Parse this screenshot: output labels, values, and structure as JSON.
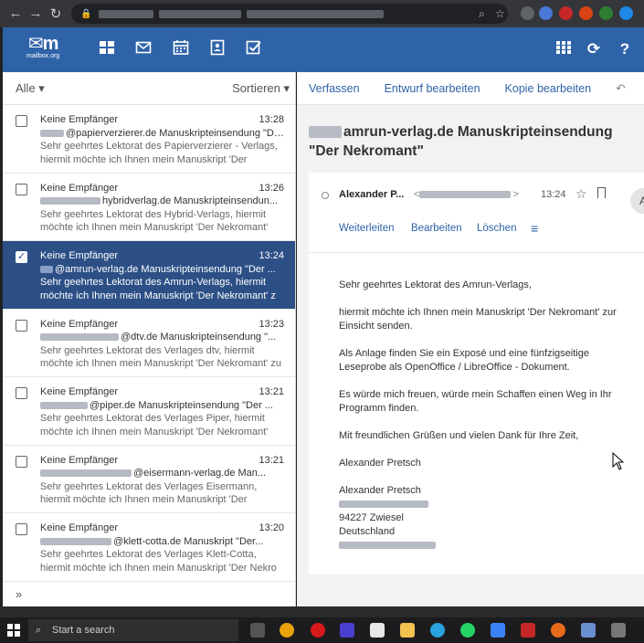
{
  "browser": {
    "url_parts": [
      "",
      "",
      ""
    ]
  },
  "app": {
    "logo_mark": "m",
    "logo_text": "mailbox.org"
  },
  "list": {
    "filter_label": "Alle",
    "sort_label": "Sortieren",
    "items": [
      {
        "from": "Keine Empfänger",
        "time": "13:28",
        "subject": "@papierverzierer.de Manuskripteinsendung \"Der ...",
        "preview": "Sehr geehrtes Lektorat des Papierverzierer - Verlags, hiermit möchte ich Ihnen mein Manuskript 'Der"
      },
      {
        "from": "Keine Empfänger",
        "time": "13:26",
        "subject": "hybridverlag.de Manuskripteinsendun...",
        "preview": "Sehr geehrtes Lektorat des Hybrid-Verlags, hiermit möchte ich Ihnen mein Manuskript 'Der Nekromant'"
      },
      {
        "from": "Keine Empfänger",
        "time": "13:24",
        "subject": "@amrun-verlag.de Manuskripteinsendung \"Der ...",
        "preview": "Sehr geehrtes Lektorat des Amrun-Verlags, hiermit möchte ich Ihnen mein Manuskript 'Der Nekromant' z"
      },
      {
        "from": "Keine Empfänger",
        "time": "13:23",
        "subject": "@dtv.de Manuskripteinsendung \"...",
        "preview": "Sehr geehrtes Lektorat des Verlages dtv, hiermit möchte ich Ihnen mein Manuskript 'Der Nekromant' zu"
      },
      {
        "from": "Keine Empfänger",
        "time": "13:21",
        "subject": "@piper.de Manuskripteinsendung \"Der ...",
        "preview": "Sehr geehrtes Lektorat des Verlages Piper, hiermit möchte ich Ihnen mein Manuskript 'Der Nekromant'"
      },
      {
        "from": "Keine Empfänger",
        "time": "13:21",
        "subject": "@eisermann-verlag.de Man...",
        "preview": "Sehr geehrtes Lektorat des Verlages Eisermann, hiermit möchte ich Ihnen mein Manuskript 'Der Nekroma"
      },
      {
        "from": "Keine Empfänger",
        "time": "13:20",
        "subject": "@klett-cotta.de Manuskript \"Der...",
        "preview": "Sehr geehrtes Lektorat des Verlages Klett-Cotta, hiermit möchte ich Ihnen mein Manuskript 'Der Nekro"
      }
    ],
    "footer": "»"
  },
  "toolbar": {
    "compose": "Verfassen",
    "edit_draft": "Entwurf bearbeiten",
    "edit_copy": "Kopie bearbeiten"
  },
  "message": {
    "subject": "amrun-verlag.de Manuskripteinsendung \"Der Nekromant\"",
    "sender": "Alexander P...",
    "time": "13:24",
    "actions": {
      "forward": "Weiterleiten",
      "edit": "Bearbeiten",
      "delete": "Löschen"
    },
    "avatar": "A",
    "body": {
      "greeting": "Sehr geehrtes Lektorat des Amrun-Verlags,",
      "p1": "hiermit möchte ich Ihnen mein Manuskript 'Der Nekromant' zur Einsicht senden.",
      "p2": "Als Anlage finden Sie ein Exposé und eine fünfzigseitige Leseprobe als OpenOffice / LibreOffice - Dokument.",
      "p3": "Es würde mich freuen, würde mein Schaffen einen Weg in Ihr Programm finden.",
      "p4": "Mit freundlichen Grüßen und vielen Dank für Ihre Zeit,",
      "sign": "Alexander Pretsch",
      "sig_name": "Alexander Pretsch",
      "sig_city": "94227 Zwiesel",
      "sig_country": "Deutschland"
    }
  },
  "taskbar": {
    "search_placeholder": "Start a search"
  },
  "colors": {
    "header": "#2f63a8",
    "selected": "#2c4f86",
    "link": "#2f63a8"
  }
}
